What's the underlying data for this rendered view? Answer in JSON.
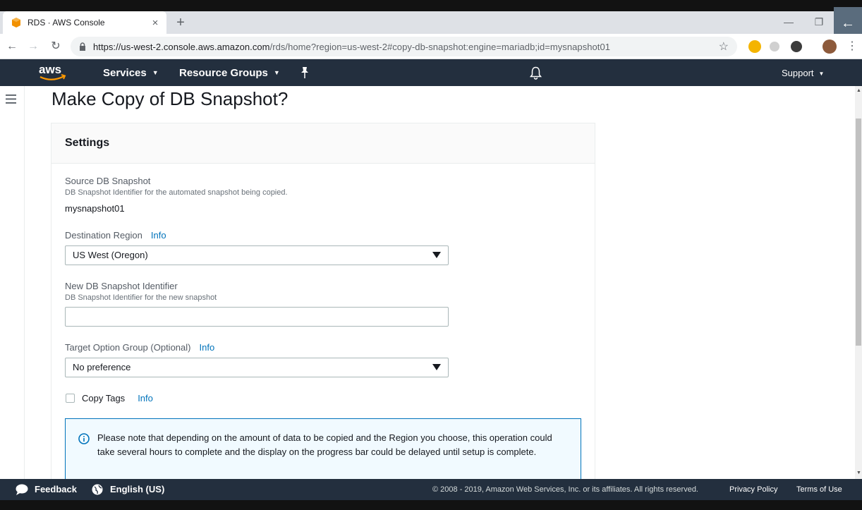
{
  "browser": {
    "tab_title": "RDS · AWS Console",
    "tab_close": "×",
    "new_tab": "+",
    "url_host": "https://us-west-2.console.aws.amazon.com",
    "url_path": "/rds/home?region=us-west-2#copy-db-snapshot:engine=mariadb;id=mysnapshot01"
  },
  "aws_nav": {
    "logo_text": "aws",
    "services": "Services",
    "resource_groups": "Resource Groups",
    "support": "Support"
  },
  "page": {
    "title": "Make Copy of DB Snapshot?"
  },
  "settings": {
    "heading": "Settings",
    "source_label": "Source DB Snapshot",
    "source_desc": "DB Snapshot Identifier for the automated snapshot being copied.",
    "source_value": "mysnapshot01",
    "dest_region_label": "Destination Region",
    "dest_region_info": "Info",
    "dest_region_value": "US West (Oregon)",
    "new_id_label": "New DB Snapshot Identifier",
    "new_id_desc": "DB Snapshot Identifier for the new snapshot",
    "new_id_value": "",
    "option_group_label": "Target Option Group (Optional)",
    "option_group_info": "Info",
    "option_group_value": "No preference",
    "copy_tags_label": "Copy Tags",
    "copy_tags_info": "Info",
    "copy_tags_checked": false,
    "notice_text": "Please note that depending on the amount of data to be copied and the Region you choose, this operation could take several hours to complete and the display on the progress bar could be delayed until setup is complete."
  },
  "footer": {
    "feedback": "Feedback",
    "language": "English (US)",
    "copyright": "© 2008 - 2019, Amazon Web Services, Inc. or its affiliates. All rights reserved.",
    "privacy": "Privacy Policy",
    "terms": "Terms of Use"
  },
  "colors": {
    "aws_nav_bg": "#232f3e",
    "link_blue": "#0073bb",
    "aws_orange": "#ff9900"
  },
  "icons": [
    "aws-favicon-icon",
    "back-arrow-icon",
    "forward-arrow-icon",
    "reload-icon",
    "lock-icon",
    "star-icon",
    "pin-icon",
    "bell-icon",
    "hamburger-icon",
    "info-circle-icon",
    "chat-bubble-icon",
    "globe-icon",
    "dropdown-arrow-icon"
  ]
}
